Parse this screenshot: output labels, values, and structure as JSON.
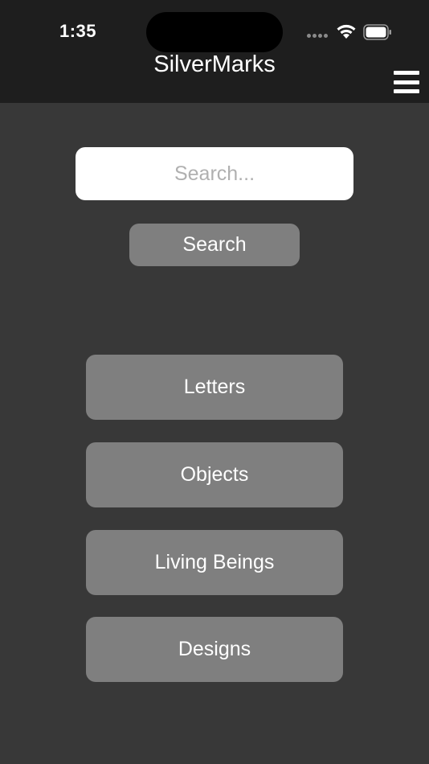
{
  "status_bar": {
    "time": "1:35",
    "icons": [
      "cellular-signal-icon",
      "wifi-icon",
      "battery-icon"
    ]
  },
  "header": {
    "title": "SilverMarks",
    "menu_icon": "hamburger-menu-icon"
  },
  "search": {
    "placeholder": "Search...",
    "value": "",
    "button_label": "Search"
  },
  "categories": [
    {
      "label": "Letters"
    },
    {
      "label": "Objects"
    },
    {
      "label": "Living Beings"
    },
    {
      "label": "Designs"
    }
  ],
  "colors": {
    "background": "#383838",
    "header_background": "#1e1e1e",
    "button_background": "#7f7f7f",
    "text": "#ffffff",
    "placeholder": "#b0b0b0"
  }
}
